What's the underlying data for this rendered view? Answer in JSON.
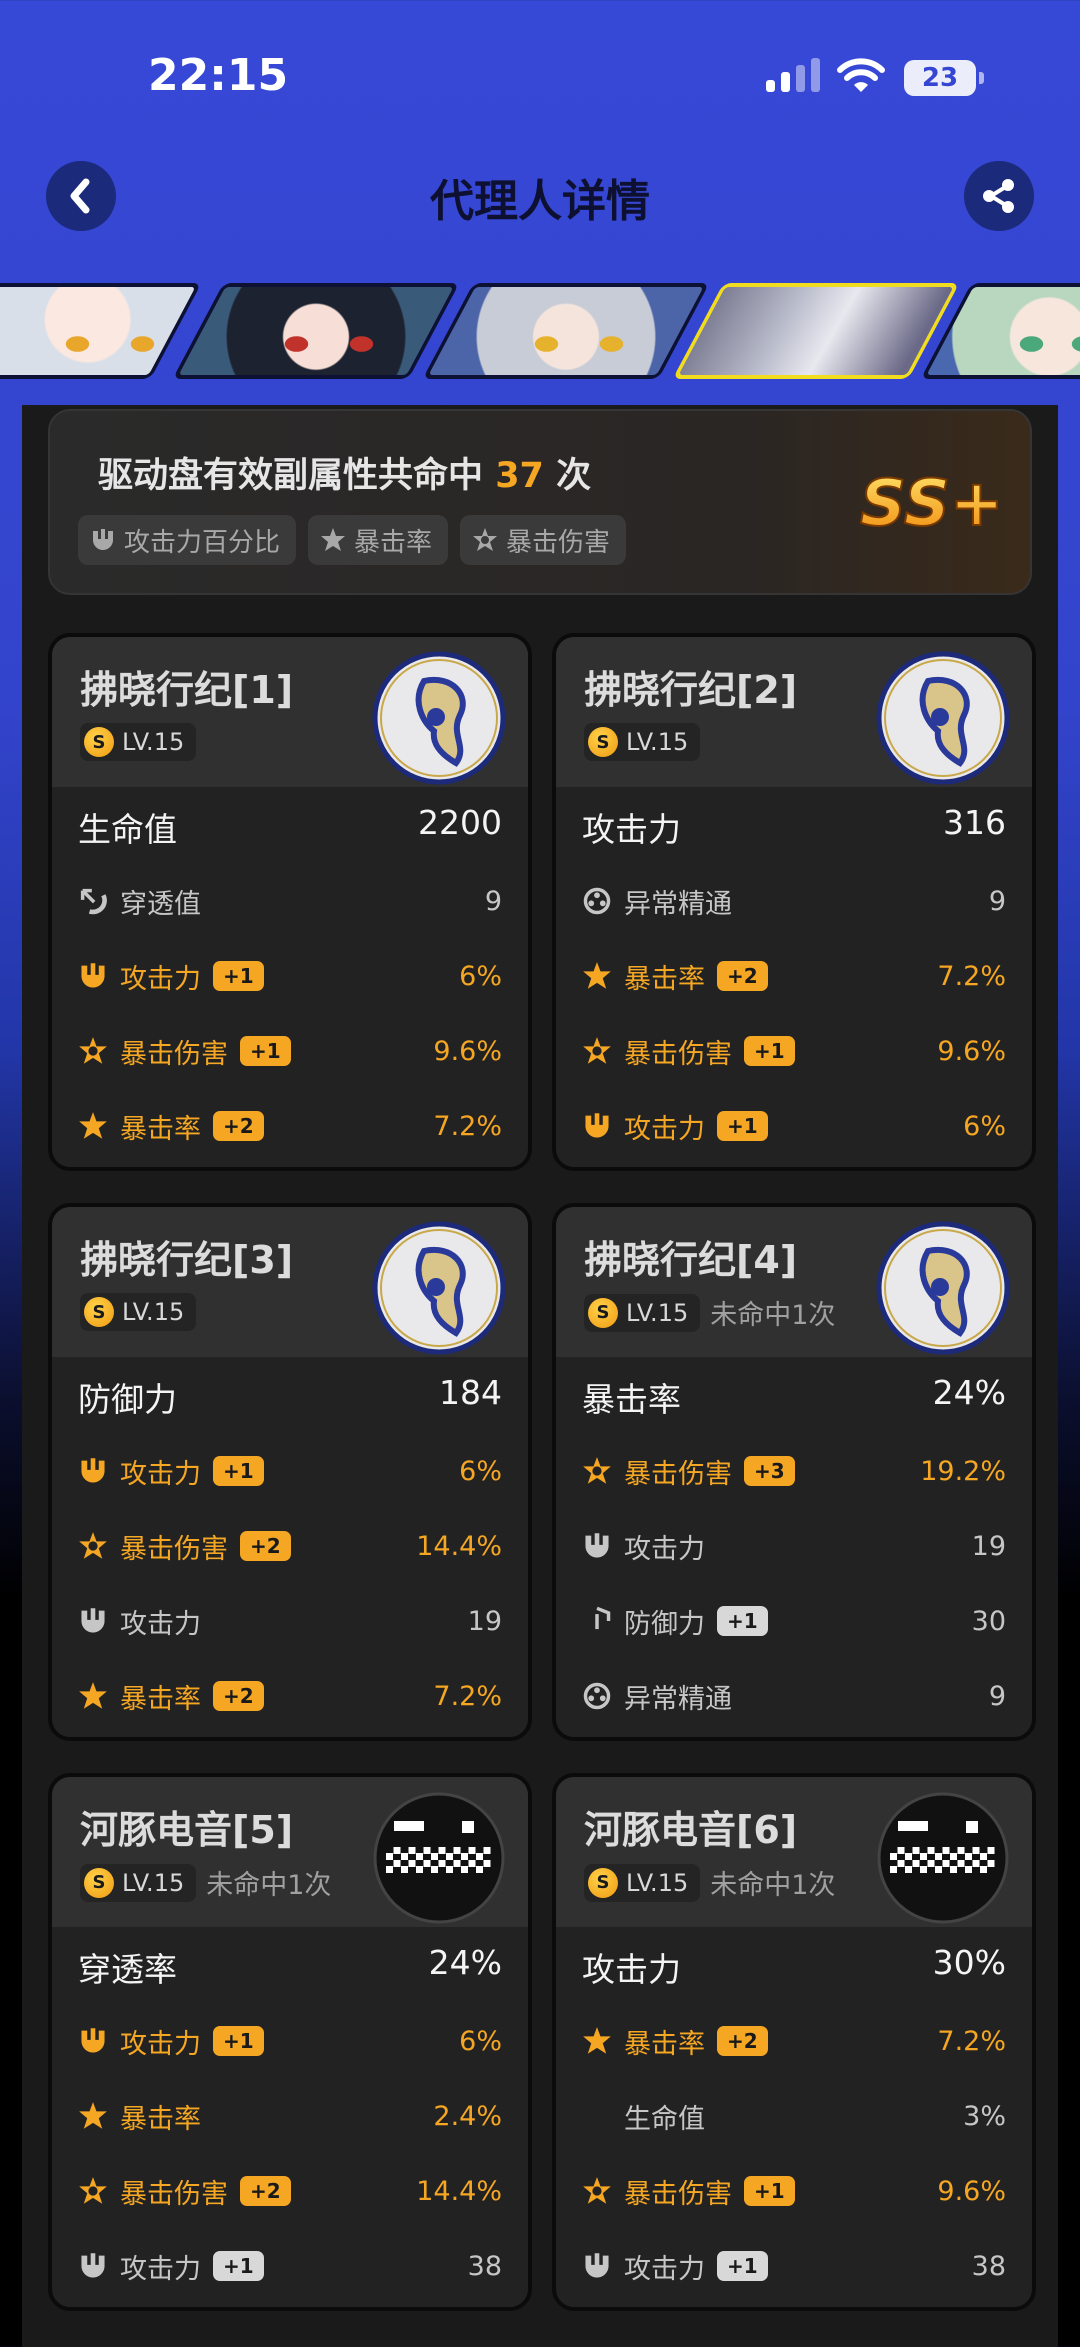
{
  "status_bar": {
    "time": "22:15",
    "battery": "23"
  },
  "header": {
    "title": "代理人详情"
  },
  "characters": [
    {
      "name": "char-1",
      "selected": false
    },
    {
      "name": "char-2",
      "selected": false
    },
    {
      "name": "char-3",
      "selected": false
    },
    {
      "name": "char-4",
      "selected": true
    },
    {
      "name": "char-5",
      "selected": false
    }
  ],
  "summary": {
    "prefix": "驱动盘有效副属性共命中 ",
    "count": "37",
    "suffix": " 次",
    "chips": [
      "攻击力百分比",
      "暴击率",
      "暴击伤害"
    ],
    "rating": "SS+"
  },
  "cards": [
    {
      "name": "拂晓行纪[1]",
      "level": "LV.15",
      "miss": "",
      "main": {
        "label": "生命值",
        "value": "2200"
      },
      "subs": [
        {
          "icon": "pen-icon",
          "label": "穿透值",
          "badge": "",
          "value": "9",
          "hit": false
        },
        {
          "icon": "atk-icon",
          "label": "攻击力",
          "badge": "+1",
          "value": "6%",
          "hit": true
        },
        {
          "icon": "crit-dmg-icon",
          "label": "暴击伤害",
          "badge": "+1",
          "value": "9.6%",
          "hit": true
        },
        {
          "icon": "crit-rate-icon",
          "label": "暴击率",
          "badge": "+2",
          "value": "7.2%",
          "hit": true
        }
      ]
    },
    {
      "name": "拂晓行纪[2]",
      "level": "LV.15",
      "miss": "",
      "main": {
        "label": "攻击力",
        "value": "316"
      },
      "subs": [
        {
          "icon": "anomaly-icon",
          "label": "异常精通",
          "badge": "",
          "value": "9",
          "hit": false
        },
        {
          "icon": "crit-rate-icon",
          "label": "暴击率",
          "badge": "+2",
          "value": "7.2%",
          "hit": true
        },
        {
          "icon": "crit-dmg-icon",
          "label": "暴击伤害",
          "badge": "+1",
          "value": "9.6%",
          "hit": true
        },
        {
          "icon": "atk-icon",
          "label": "攻击力",
          "badge": "+1",
          "value": "6%",
          "hit": true
        }
      ]
    },
    {
      "name": "拂晓行纪[3]",
      "level": "LV.15",
      "miss": "",
      "main": {
        "label": "防御力",
        "value": "184"
      },
      "subs": [
        {
          "icon": "atk-icon",
          "label": "攻击力",
          "badge": "+1",
          "value": "6%",
          "hit": true
        },
        {
          "icon": "crit-dmg-icon",
          "label": "暴击伤害",
          "badge": "+2",
          "value": "14.4%",
          "hit": true
        },
        {
          "icon": "atk-icon",
          "label": "攻击力",
          "badge": "",
          "value": "19",
          "hit": false
        },
        {
          "icon": "crit-rate-icon",
          "label": "暴击率",
          "badge": "+2",
          "value": "7.2%",
          "hit": true
        }
      ]
    },
    {
      "name": "拂晓行纪[4]",
      "level": "LV.15",
      "miss": "未命中1次",
      "main": {
        "label": "暴击率",
        "value": "24%"
      },
      "subs": [
        {
          "icon": "crit-dmg-icon",
          "label": "暴击伤害",
          "badge": "+3",
          "value": "19.2%",
          "hit": true
        },
        {
          "icon": "atk-icon",
          "label": "攻击力",
          "badge": "",
          "value": "19",
          "hit": false
        },
        {
          "icon": "def-icon",
          "label": "防御力",
          "badge": "+1",
          "value": "30",
          "hit": false
        },
        {
          "icon": "anomaly-icon",
          "label": "异常精通",
          "badge": "",
          "value": "9",
          "hit": false
        }
      ]
    },
    {
      "name": "河豚电音[5]",
      "level": "LV.15",
      "miss": "未命中1次",
      "main": {
        "label": "穿透率",
        "value": "24%"
      },
      "subs": [
        {
          "icon": "atk-icon",
          "label": "攻击力",
          "badge": "+1",
          "value": "6%",
          "hit": true
        },
        {
          "icon": "crit-rate-icon",
          "label": "暴击率",
          "badge": "",
          "value": "2.4%",
          "hit": true
        },
        {
          "icon": "crit-dmg-icon",
          "label": "暴击伤害",
          "badge": "+2",
          "value": "14.4%",
          "hit": true
        },
        {
          "icon": "atk-icon",
          "label": "攻击力",
          "badge": "+1",
          "value": "38",
          "hit": false
        }
      ]
    },
    {
      "name": "河豚电音[6]",
      "level": "LV.15",
      "miss": "未命中1次",
      "main": {
        "label": "攻击力",
        "value": "30%"
      },
      "subs": [
        {
          "icon": "crit-rate-icon",
          "label": "暴击率",
          "badge": "+2",
          "value": "7.2%",
          "hit": true
        },
        {
          "icon": "hp-icon",
          "label": "生命值",
          "badge": "",
          "value": "3%",
          "hit": false
        },
        {
          "icon": "crit-dmg-icon",
          "label": "暴击伤害",
          "badge": "+1",
          "value": "9.6%",
          "hit": true
        },
        {
          "icon": "atk-icon",
          "label": "攻击力",
          "badge": "+1",
          "value": "38",
          "hit": false
        }
      ]
    }
  ],
  "colors": {
    "accent": "#f5a623",
    "header_bg": "#3648d6",
    "card_bg": "#222222"
  }
}
